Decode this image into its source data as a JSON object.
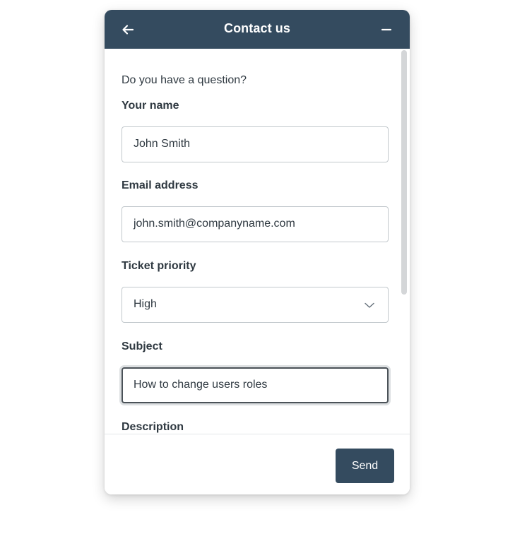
{
  "header": {
    "title": "Contact us",
    "back_icon": "arrow-left-icon",
    "minimize_icon": "minus-icon",
    "background_color": "#344b5f"
  },
  "form": {
    "intro": "Do you have a question?",
    "name": {
      "label": "Your name",
      "value": "John Smith"
    },
    "email": {
      "label": "Email address",
      "value": "john.smith@companyname.com"
    },
    "priority": {
      "label": "Ticket priority",
      "selected": "High",
      "icon": "chevron-down-icon"
    },
    "subject": {
      "label": "Subject",
      "value": "How to change users roles"
    },
    "description": {
      "label": "Description"
    }
  },
  "footer": {
    "send_label": "Send"
  }
}
